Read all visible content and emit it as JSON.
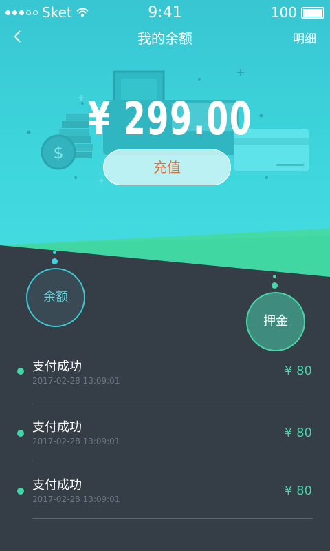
{
  "status": {
    "carrier": "Sket",
    "time": "9:41",
    "battery": "100"
  },
  "nav": {
    "title": "我的余额",
    "detail": "明细"
  },
  "balance": {
    "amount": "¥ 299.00",
    "recharge_label": "充值"
  },
  "tabs": {
    "balance_label": "余额",
    "deposit_label": "押金"
  },
  "records": [
    {
      "title": "支付成功",
      "time": "2017-02-28  13:09:01",
      "amount": "¥ 80"
    },
    {
      "title": "支付成功",
      "time": "2017-02-28  13:09:01",
      "amount": "¥ 80"
    },
    {
      "title": "支付成功",
      "time": "2017-02-28  13:09:01",
      "amount": "¥ 80"
    }
  ],
  "colors": {
    "hero": "#3fd7de",
    "accent_green": "#49d4a7",
    "panel": "#353d47",
    "recharge_text": "#e0703a"
  },
  "icons": [
    "signal-dots-icon",
    "wifi-icon",
    "battery-icon",
    "back-chevron-icon",
    "dollar-coin-icon"
  ]
}
